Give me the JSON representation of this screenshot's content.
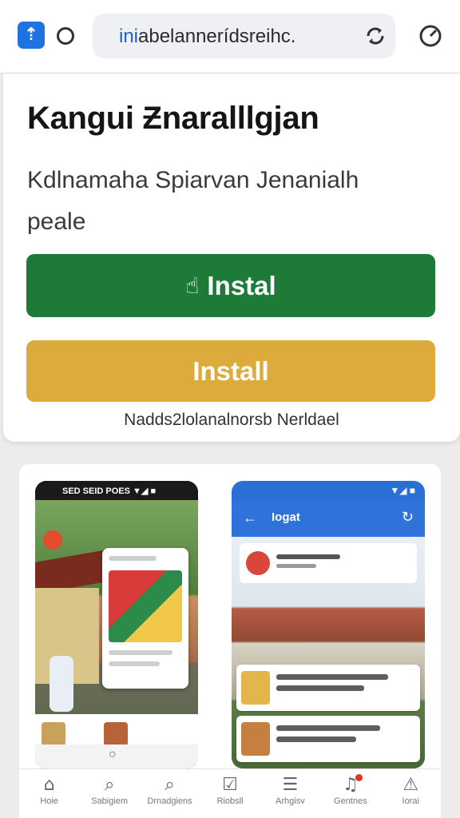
{
  "browser": {
    "url_prefix": "ini",
    "url_rest": "abelannerídsreihc.",
    "icons": [
      "app-tab-icon",
      "circle-icon",
      "reload-icon",
      "menu-icon"
    ]
  },
  "app": {
    "title": "Kangui Ƶnaralllgjan",
    "description": "Kdlnamaha Spiarvan Jenanialh peale",
    "primary_button": "Instal",
    "secondary_button": "Install",
    "footnote": "Nadds2lolanalnorsb Nerldael"
  },
  "gallery": {
    "left_status": "SED SEID POES",
    "left_status_icons": "▼◢ ■",
    "right_status": "▼◢ ■",
    "right_back": "←",
    "right_title": "Iogat",
    "right_refresh": "↻",
    "bottom_circle": "○"
  },
  "bottom_nav": {
    "items": [
      {
        "label": "Hoie",
        "icon": "home-icon",
        "glyph": "⌂"
      },
      {
        "label": "Sabigiem",
        "icon": "search-icon",
        "glyph": "⌕"
      },
      {
        "label": "Drnadgiens",
        "icon": "search-icon",
        "glyph": "⌕"
      },
      {
        "label": "Riobsll",
        "icon": "checkbox-icon",
        "glyph": "☑"
      },
      {
        "label": "Arhgisv",
        "icon": "list-icon",
        "glyph": "☰"
      },
      {
        "label": "Gentnes",
        "icon": "notification-icon",
        "glyph": "♫"
      },
      {
        "label": "Iorai",
        "icon": "warning-icon",
        "glyph": "⚠"
      }
    ]
  },
  "colors": {
    "primary_button": "#1e7a37",
    "secondary_button": "#ddaa3c",
    "url_highlight": "#1f63c8",
    "right_phone_appbar": "#2f72d9"
  }
}
